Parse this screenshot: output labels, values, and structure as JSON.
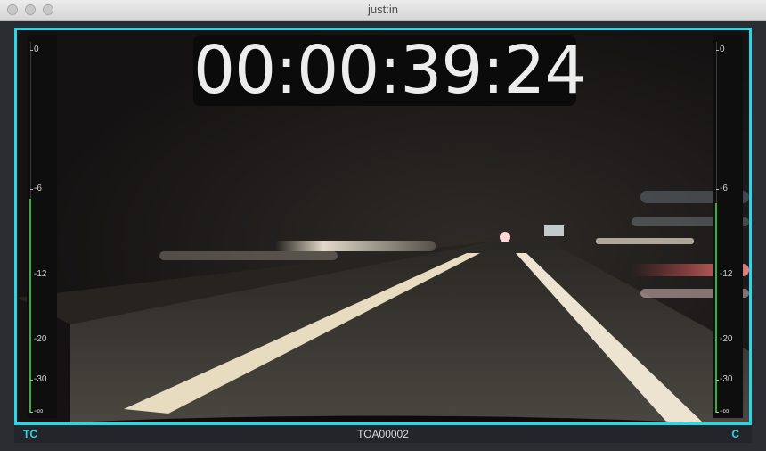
{
  "window": {
    "title": "just:in"
  },
  "timecode": "00:00:39:24",
  "meters": {
    "scale_labels": [
      "0",
      "-6",
      "-12",
      "-20",
      "-30",
      "-∞"
    ],
    "left_level_db": -6,
    "right_level_db": -6
  },
  "bottom": {
    "left_label": "TC",
    "center_label": "TOA00002",
    "right_label": "C"
  },
  "colors": {
    "accent": "#29d8e6",
    "meter_green": "#2fb52f"
  }
}
